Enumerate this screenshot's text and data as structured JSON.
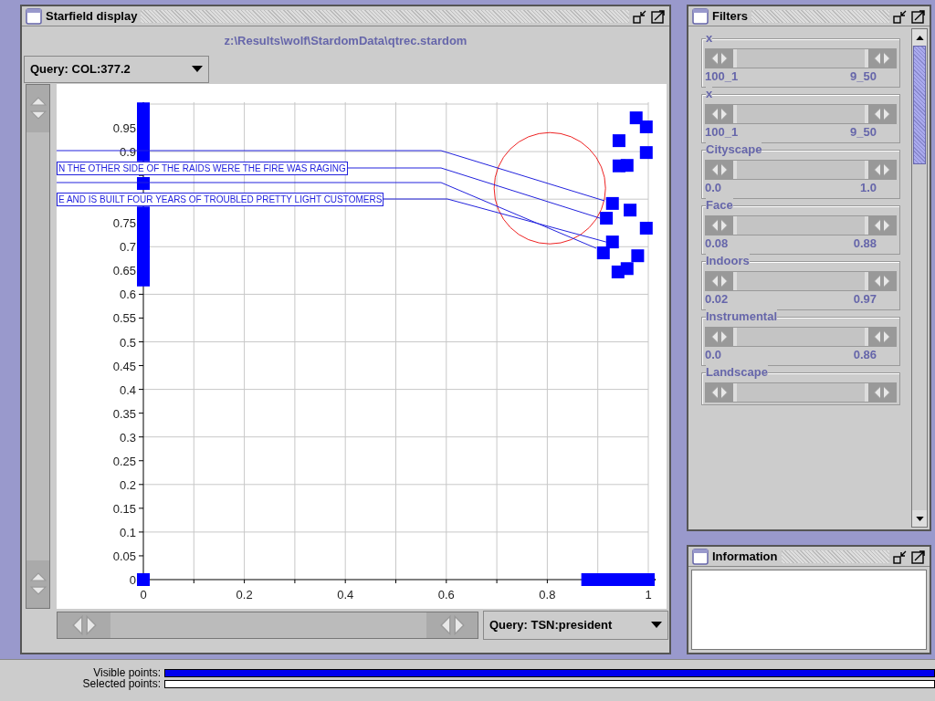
{
  "starfield": {
    "title": "Starfield display",
    "path": "z:\\Results\\wolf\\StardomData\\qtrec.stardom",
    "y_query": "Query: COL:377.2",
    "x_query": "Query: TSN:president",
    "chart_data": {
      "type": "scatter",
      "xlim": [
        0,
        1
      ],
      "ylim": [
        0,
        1
      ],
      "xticks": [
        {
          "value": 0,
          "label": "0"
        },
        {
          "value": 0.2,
          "label": "0.2"
        },
        {
          "value": 0.4,
          "label": "0.4"
        },
        {
          "value": 0.6,
          "label": "0.6"
        },
        {
          "value": 0.8,
          "label": "0.8"
        },
        {
          "value": 1,
          "label": "1"
        }
      ],
      "yticks": [
        {
          "value": 0,
          "label": "0"
        },
        {
          "value": 0.05,
          "label": "0.05"
        },
        {
          "value": 0.1,
          "label": "0.1"
        },
        {
          "value": 0.15,
          "label": "0.15"
        },
        {
          "value": 0.2,
          "label": "0.2"
        },
        {
          "value": 0.25,
          "label": "0.25"
        },
        {
          "value": 0.3,
          "label": "0.3"
        },
        {
          "value": 0.35,
          "label": "0.35"
        },
        {
          "value": 0.4,
          "label": "0.4"
        },
        {
          "value": 0.45,
          "label": "0.45"
        },
        {
          "value": 0.5,
          "label": "0.5"
        },
        {
          "value": 0.55,
          "label": "0.55"
        },
        {
          "value": 0.6,
          "label": "0.6"
        },
        {
          "value": 0.65,
          "label": "0.65"
        },
        {
          "value": 0.7,
          "label": "0.7"
        },
        {
          "value": 0.75,
          "label": "0.75"
        },
        {
          "value": 0.9,
          "label": "0.9"
        },
        {
          "value": 0.95,
          "label": "0.95"
        }
      ],
      "grid": true,
      "x": [
        0,
        0,
        0,
        0,
        0,
        0,
        0,
        0,
        0,
        0,
        0,
        0,
        0,
        0,
        0.976,
        0.996,
        0.942,
        0.996,
        0.942,
        0.958,
        0.929,
        0.917,
        0.964,
        0.996,
        0.929,
        0.911,
        0.979,
        0.94,
        0.958,
        0.88,
        0.9,
        0.92,
        0.94,
        0.96,
        0.98,
        1
      ],
      "series": [
        {
          "color": "#0000ff",
          "values": [
            0.99,
            0.965,
            0.94,
            0.915,
            0.893,
            0.833,
            0.771,
            0.745,
            0.72,
            0.695,
            0.67,
            0.645,
            0.63,
            0,
            0.971,
            0.952,
            0.923,
            0.898,
            0.87,
            0.871,
            0.791,
            0.76,
            0.777,
            0.739,
            0.71,
            0.687,
            0.681,
            0.647,
            0.654,
            0,
            0,
            0,
            0,
            0,
            0,
            0
          ]
        }
      ],
      "annotations": [
        {
          "text": "N THE OTHER SIDE OF THE RAIDS WERE THE FIRE WAS RAGING",
          "x": 0.917,
          "y": 0.76
        },
        {
          "text": "E AND IS BUILT FOUR YEARS OF TROUBLED PRETTY LIGHT CUSTOMERS",
          "x": 0.929,
          "y": 0.71
        }
      ]
    }
  },
  "filters": {
    "title": "Filters",
    "items": [
      {
        "label": "x",
        "thumbs": [
          {
            "level": 0
          },
          {
            "level": 1
          }
        ],
        "min": "100_1",
        "max": "9_50"
      },
      {
        "label": "x",
        "thumbs": [
          {
            "level": 0
          },
          {
            "level": 1
          }
        ],
        "min": "100_1",
        "max": "9_50"
      },
      {
        "label": "Cityscape",
        "thumbs": [
          {
            "level": 0
          },
          {
            "level": 1
          }
        ],
        "min": "0.0",
        "max": "1.0"
      },
      {
        "label": "Face",
        "thumbs": [
          {
            "level": 0
          },
          {
            "level": 1
          }
        ],
        "min": "0.08",
        "max": "0.88"
      },
      {
        "label": "Indoors",
        "thumbs": [
          {
            "level": 0
          },
          {
            "level": 1
          }
        ],
        "min": "0.02",
        "max": "0.97"
      },
      {
        "label": "Instrumental",
        "thumbs": [
          {
            "level": 0
          },
          {
            "level": 1
          }
        ],
        "min": "0.0",
        "max": "0.86"
      },
      {
        "label": "Landscape",
        "thumbs": [
          {
            "level": 0
          },
          {
            "level": 1
          }
        ]
      }
    ]
  },
  "information": {
    "title": "Information"
  },
  "status": [
    {
      "label": "Visible points:",
      "level": 1
    },
    {
      "label": "Selected points:",
      "level": 0
    }
  ]
}
